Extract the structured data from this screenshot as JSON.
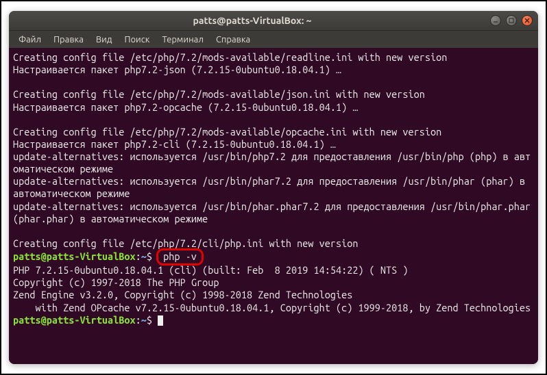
{
  "window": {
    "title": "patts@patts-VirtualBox: ~"
  },
  "menu": {
    "file": "Файл",
    "edit": "Правка",
    "view": "Вид",
    "search": "Поиск",
    "terminal": "Терминал",
    "help": "Справка"
  },
  "term": {
    "l1": "Creating config file /etc/php/7.2/mods-available/readline.ini with new version",
    "l2": "Настраивается пакет php7.2-json (7.2.15-0ubuntu0.18.04.1) …",
    "l3": "",
    "l4": "Creating config file /etc/php/7.2/mods-available/json.ini with new version",
    "l5": "Настраивается пакет php7.2-opcache (7.2.15-0ubuntu0.18.04.1) …",
    "l6": "",
    "l7": "Creating config file /etc/php/7.2/mods-available/opcache.ini with new version",
    "l8": "Настраивается пакет php7.2-cli (7.2.15-0ubuntu0.18.04.1) …",
    "l9": "update-alternatives: используется /usr/bin/php7.2 для предоставления /usr/bin/php (php) в автоматическом режиме",
    "l10": "update-alternatives: используется /usr/bin/phar7.2 для предоставления /usr/bin/phar (phar) в автоматическом режиме",
    "l11": "update-alternatives: используется /usr/bin/phar.phar7.2 для предоставления /usr/bin/phar.phar (phar.phar) в автоматическом режиме",
    "l12": "",
    "l13": "Creating config file /etc/php/7.2/cli/php.ini with new version",
    "prompt_user": "patts@patts-VirtualBox",
    "prompt_colon": ":",
    "prompt_path": "~",
    "prompt_dollar": "$ ",
    "cmd1": "php -v",
    "l15": "PHP 7.2.15-0ubuntu0.18.04.1 (cli) (built: Feb  8 2019 14:54:22) ( NTS )",
    "l16": "Copyright (c) 1997-2018 The PHP Group",
    "l17": "Zend Engine v3.2.0, Copyright (c) 1998-2018 Zend Technologies",
    "l18": "    with Zend OPcache v7.2.15-0ubuntu0.18.04.1, Copyright (c) 1999-2018, by Zend Technologies"
  }
}
